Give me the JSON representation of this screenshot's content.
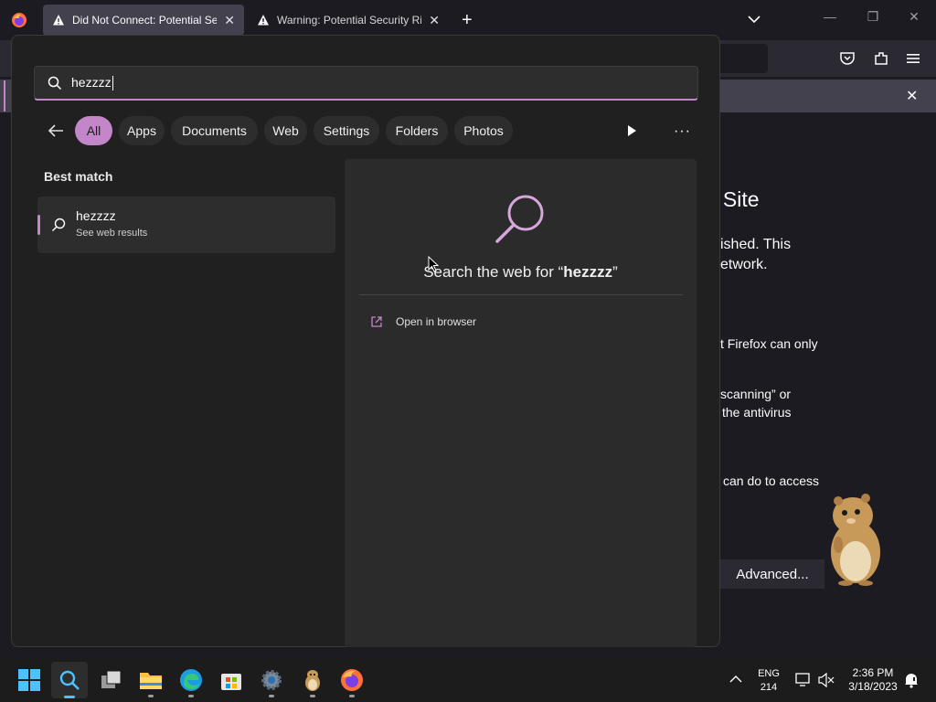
{
  "browser": {
    "tabs": [
      {
        "title": "Did Not Connect: Potential Security Issue",
        "active": true
      },
      {
        "title": "Warning: Potential Security Risk Ahead",
        "active": false
      }
    ],
    "page_fragments": {
      "heading": "s Site",
      "line1": "ished. This",
      "line2": "etwork.",
      "line3": "t Firefox can only",
      "line4": "scanning” or",
      "line5": "the antivirus",
      "line6": "can do to access",
      "advanced_button": "Advanced..."
    }
  },
  "search": {
    "query": "hezzzz",
    "filters": [
      "All",
      "Apps",
      "Documents",
      "Web",
      "Settings",
      "Folders",
      "Photos"
    ],
    "active_filter": "All",
    "best_match_label": "Best match",
    "result": {
      "title": "hezzzz",
      "subtitle": "See web results"
    },
    "preview": {
      "heading_prefix": "Search the web for “",
      "heading_query": "hezzzz",
      "heading_suffix": "”",
      "open_in_browser": "Open in browser"
    }
  },
  "taskbar": {
    "language": "ENG",
    "language_sub": "214",
    "time": "2:36 PM",
    "date": "3/18/2023"
  },
  "colors": {
    "accent": "#c387c9",
    "flyout_bg": "#202020",
    "taskbar_bg": "#1c1c1c",
    "browser_bg": "#1c1b22"
  }
}
